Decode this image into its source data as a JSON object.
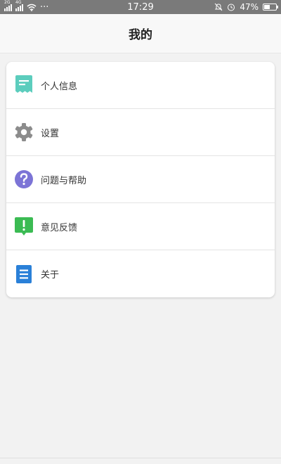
{
  "status_bar": {
    "left_tag_1": "2G",
    "left_tag_2": "4G",
    "dots": "···",
    "time": "17:29",
    "battery_percent_text": "47%",
    "battery_level": 0.47
  },
  "header": {
    "title": "我的"
  },
  "menu": {
    "items": [
      {
        "label": "个人信息",
        "icon": "profile-card-icon",
        "color": "#5ccdbd"
      },
      {
        "label": "设置",
        "icon": "gear-icon",
        "color": "#8c8c8c"
      },
      {
        "label": "问题与帮助",
        "icon": "question-icon",
        "color": "#7c74d6"
      },
      {
        "label": "意见反馈",
        "icon": "feedback-icon",
        "color": "#3bbb53"
      },
      {
        "label": "关于",
        "icon": "document-icon",
        "color": "#2a80d8"
      }
    ]
  }
}
